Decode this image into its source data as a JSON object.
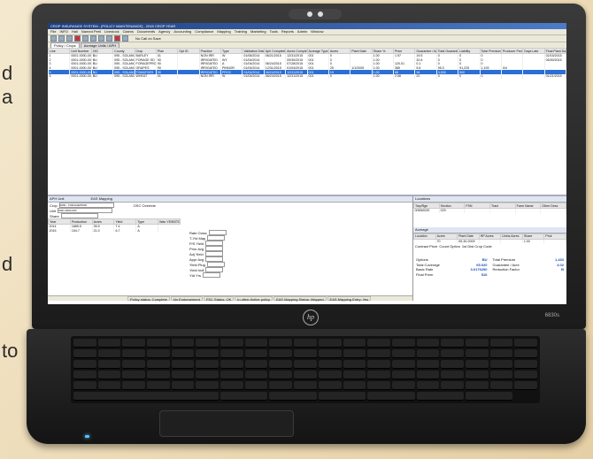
{
  "side_letters": [
    "d",
    "a",
    "d",
    "to"
  ],
  "app": {
    "title": "CROP INSURANCE SYSTEM - [POLICY MAINTENANCE] - 2015 CROP YEAR",
    "menu": [
      "File",
      "INFO",
      "Hail",
      "Named Peril",
      "Livestock",
      "Claims",
      "Documents",
      "Agency",
      "Accounting",
      "Compliance",
      "Mapping",
      "Training",
      "Marketing",
      "Tools",
      "Reports",
      "Admin",
      "Window"
    ],
    "toolbar_note": "No Call on Save",
    "tabs": [
      "Policy / Crops",
      "Acreage Units / APH"
    ],
    "grid_columns": [
      "Line",
      "Unit Number",
      "OIC",
      "County",
      "Crop",
      "Plan",
      "Opt ID",
      "Practice",
      "Type",
      "Validation Date",
      "Aph Completed",
      "Acres Completed",
      "Acreage Type",
      "Acres",
      "Plant Date",
      "Share %",
      "Price",
      "Guarantee / Acre",
      "Total Guarantee",
      "Liability",
      "Total Premium",
      "Producer Premium",
      "Days Late",
      "Final Plant Date"
    ],
    "grid_rows": [
      [
        "1",
        "0001-0000-000",
        "BU",
        "095 - SOLANO",
        "BARLEY",
        "01",
        "",
        "NON IRR",
        "W",
        "01/06/2014",
        "06/21/2015",
        "12/31/2015",
        "001",
        "0",
        "",
        "1.00",
        "1.97",
        "19.5",
        "0",
        "0",
        "0",
        "",
        "",
        "02/15/2015"
      ],
      [
        "2",
        "0001-0000-000",
        "BU",
        "095 - SOLANO",
        "FORAGE SD",
        "90",
        "",
        "IRRIGATED",
        "WY",
        "01/04/2014",
        "",
        "09/30/2015",
        "001",
        "0",
        "",
        "1.00",
        "",
        "32.6",
        "0",
        "0",
        "0",
        "",
        "",
        "05/30/2015"
      ],
      [
        "3",
        "0001-0000-000",
        "BU",
        "095 - SOLANO",
        "FORAGEPROD",
        "90",
        "",
        "IRRIGATED",
        "A",
        "01/04/2014",
        "06/24/2015",
        "07/28/2015",
        "001",
        "0",
        "",
        "1.00",
        "120.01",
        "0.1",
        "0",
        "0",
        "0",
        "",
        "",
        ""
      ],
      [
        "4",
        "0001-0000-000",
        "BU",
        "095 - SOLANO",
        "GRAPES",
        "90",
        "",
        "IRRIGATED",
        "PINNOR",
        "01/04/2014",
        "12/31/2015",
        "01/04/2015",
        "001",
        "25",
        "1/1/2005",
        "1.00",
        "385",
        "5.6",
        "95.0",
        "91,225",
        "1,193",
        "0/4",
        ""
      ],
      [
        "5",
        "0001-0000-000",
        "BU",
        "095 - SOLANO",
        "TOMATOES",
        "90",
        "",
        "IRRIGATED",
        "PROC",
        "01/04/2014",
        "06/24/2015",
        "12/31/2015",
        "001",
        "19",
        "",
        "1.00",
        "88",
        "36",
        "4,530",
        "500",
        "",
        "",
        "",
        ""
      ],
      [
        "6",
        "0001-0000-000",
        "BU",
        "095 - SOLANO",
        "WHEAT",
        "01",
        "",
        "NON IRR",
        "W",
        "01/04/2014",
        "06/24/2015",
        "12/31/2015",
        "001",
        "0",
        "",
        "1.00",
        "2.58",
        "22",
        "0",
        "0",
        "0",
        "",
        "",
        "01/21/2015"
      ]
    ],
    "selected_row": 4,
    "aph": {
      "title": "APH Unit",
      "eas_title": "EAS Mapping",
      "labels": [
        "Crop",
        "Unit",
        "Share"
      ],
      "crop_value": "0090 - FORAGEPROD",
      "unit_value": "0001-0000-000",
      "override_label": "OSC Override",
      "columns": [
        "Year",
        "Production",
        "Acres",
        "Yield",
        "Type",
        "Wan YE/BSTD Verified"
      ],
      "rows": [
        [
          "2014",
          "1865.5",
          "35.5",
          "7.4",
          "A"
        ],
        [
          "2015",
          "154.7",
          "21.0",
          "6.7",
          "A"
        ]
      ],
      "right_labels": [
        "Rate Class",
        "T-Yld Map",
        "P/S Yield",
        "Prior Avg",
        "Adj Yield",
        "Appr Avg",
        "Yield Plug",
        "Yield Indl",
        "Ytd Yrs"
      ]
    },
    "locations": {
      "title": "Locations",
      "columns": [
        "Twp/Rge",
        "Section",
        "FSN",
        "Tract",
        "Farm Name",
        "Other Desc"
      ],
      "row": [
        "005N002E",
        "029",
        "",
        "",
        "",
        ""
      ]
    },
    "acreage": {
      "title": "Acreage",
      "headers": [
        "Location",
        "Acres",
        "Plant Date",
        "HP Acres",
        "Unins Acres",
        "Share",
        "Prck"
      ],
      "values": [
        "",
        "70",
        "05-30-2009",
        "",
        "",
        "1.00",
        ""
      ],
      "contract_labels": [
        "Contract Price",
        "Count Option",
        "1st Dist Crop Code"
      ]
    },
    "summary": [
      {
        "k": "Options",
        "v": "BU"
      },
      {
        "k": "Total Coverage",
        "v": "65.020"
      },
      {
        "k": "Basic Rate",
        "v": "0.0176290"
      },
      {
        "k": "Final Prem",
        "v": "516"
      }
    ],
    "summary_right": [
      {
        "k": "Total Premium",
        "v": "1,433"
      },
      {
        "k": "Guarantee / Acre",
        "v": "4.02"
      },
      {
        "k": "Reduction Factor",
        "v": "B"
      }
    ],
    "status": [
      "Policy status: Complete",
      "No Endorsement",
      "FSC Status: OK",
      "In other Active policy",
      "EAS Mapping Status: Mapped",
      "EAS Mapping Entry: Yes"
    ]
  },
  "laptop": {
    "brand": "hp",
    "model": "6830s"
  }
}
